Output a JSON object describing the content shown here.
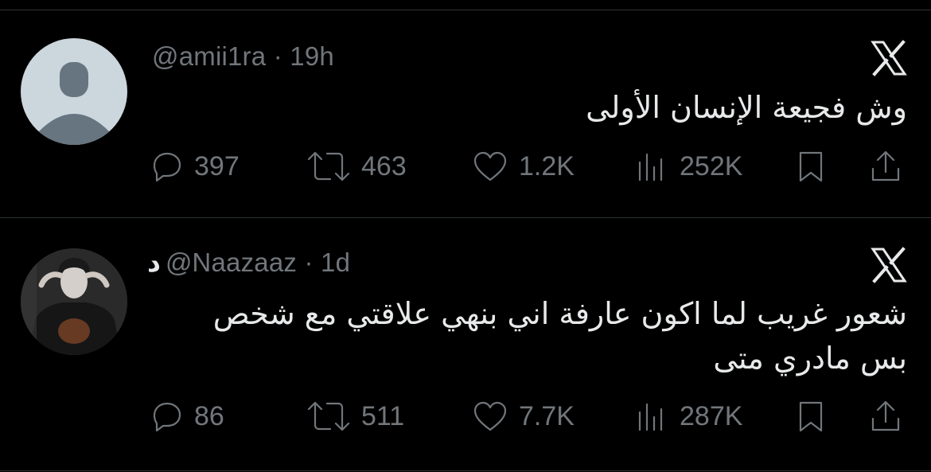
{
  "tweets": [
    {
      "display_name": "",
      "handle": "@amii1ra",
      "separator": "·",
      "time": "19h",
      "text": "وش فجيعة الإنسان الأولى",
      "replies": "397",
      "retweets": "463",
      "likes": "1.2K",
      "views": "252K"
    },
    {
      "display_name": "د",
      "handle": "@Naazaaz",
      "separator": "·",
      "time": "1d",
      "text": "شعور غريب لما اكون عارفة اني بنهي علاقتي مع شخص\nبس مادري متى",
      "replies": "86",
      "retweets": "511",
      "likes": "7.7K",
      "views": "287K"
    }
  ],
  "icons": [
    "x-logo-icon",
    "reply-icon",
    "retweet-icon",
    "like-icon",
    "views-icon",
    "bookmark-icon",
    "share-icon"
  ],
  "colors": {
    "background": "#000000",
    "text": "#e7e9ea",
    "secondary": "#71767b",
    "divider": "#2f3336"
  }
}
